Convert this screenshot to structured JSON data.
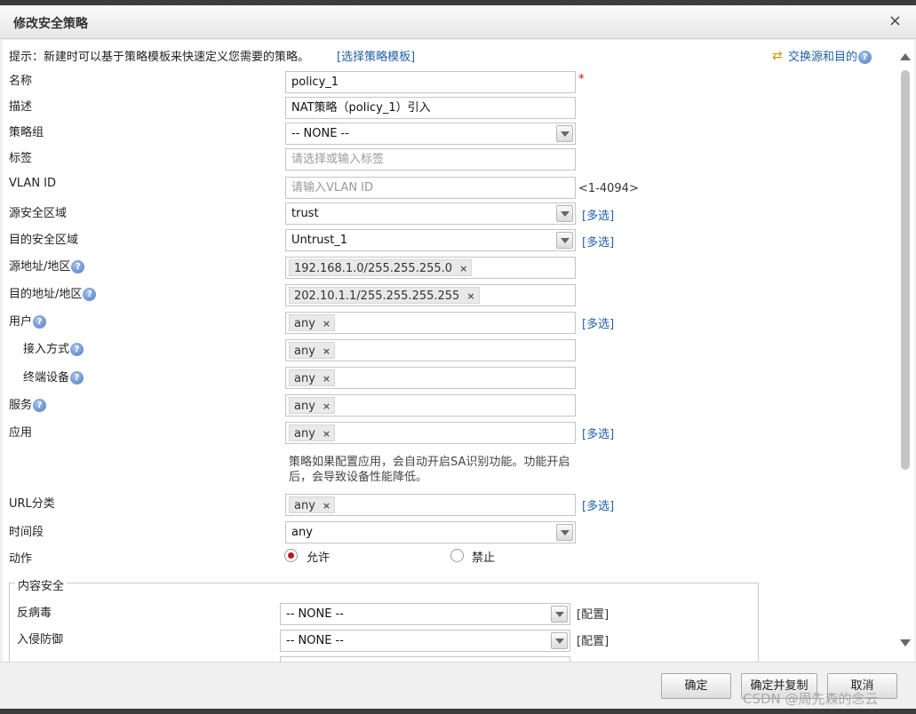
{
  "dialog": {
    "title": "修改安全策略",
    "close_glyph": "×"
  },
  "hint": {
    "text": "提示：新建时可以基于策略模板来快速定义您需要的策略。",
    "link": "[选择策略模板]"
  },
  "swap": {
    "label": "交换源和目的",
    "icon": "swap-icon"
  },
  "help_glyph": "?",
  "multi_label": "[多选]",
  "config_label": "[配置]",
  "required_mark": "*",
  "remove_glyph": "×",
  "form": {
    "name": {
      "label": "名称",
      "value": "policy_1"
    },
    "desc": {
      "label": "描述",
      "value": "NAT策略（policy_1）引入"
    },
    "group": {
      "label": "策略组",
      "value": "-- NONE --"
    },
    "tag": {
      "label": "标签",
      "placeholder": "请选择或输入标签"
    },
    "vlan": {
      "label": "VLAN ID",
      "placeholder": "请输入VLAN ID",
      "range": "<1-4094>"
    },
    "src_zone": {
      "label": "源安全区域",
      "value": "trust"
    },
    "dst_zone": {
      "label": "目的安全区域",
      "value": "Untrust_1"
    },
    "src_addr": {
      "label": "源地址/地区",
      "tag": "192.168.1.0/255.255.255.0"
    },
    "dst_addr": {
      "label": "目的地址/地区",
      "tag": "202.10.1.1/255.255.255.255"
    },
    "user": {
      "label": "用户",
      "tag": "any"
    },
    "access": {
      "label": "接入方式",
      "tag": "any"
    },
    "terminal": {
      "label": "终端设备",
      "tag": "any"
    },
    "service": {
      "label": "服务",
      "tag": "any"
    },
    "app": {
      "label": "应用",
      "tag": "any",
      "note": "策略如果配置应用，会自动开启SA识别功能。功能开启后，会导致设备性能降低。"
    },
    "url": {
      "label": "URL分类",
      "tag": "any"
    },
    "time": {
      "label": "时间段",
      "value": "any"
    },
    "action": {
      "label": "动作",
      "allow": "允许",
      "deny": "禁止",
      "selected": "允许"
    }
  },
  "content_security": {
    "legend": "内容安全",
    "antivirus": {
      "label": "反病毒",
      "value": "-- NONE --"
    },
    "ips": {
      "label": "入侵防御",
      "value": "-- NONE --"
    }
  },
  "buttons": {
    "ok": "确定",
    "ok_copy": "确定并复制",
    "cancel": "取消"
  },
  "watermark": "CSDN @周先森的念云",
  "colors": {
    "link": "#1f5fa8",
    "required": "#ee0000",
    "radio_selected": "#c01616"
  }
}
